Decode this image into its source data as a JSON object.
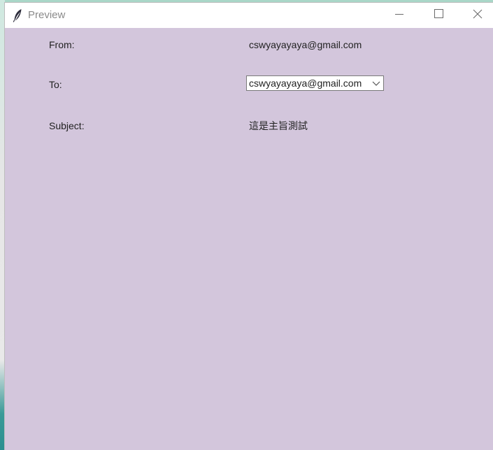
{
  "window": {
    "title": "Preview",
    "icon": "feather-icon",
    "controls": [
      "minimize-icon",
      "maximize-icon",
      "close-icon"
    ]
  },
  "form": {
    "from_label": "From:",
    "from_value": "cswyayayaya@gmail.com",
    "to_label": "To:",
    "to_selected": "cswyayayaya@gmail.com",
    "subject_label": "Subject:",
    "subject_value": "這是主旨測試"
  },
  "colors": {
    "content_background": "#d3c6dc",
    "titlebar_background": "#ffffff",
    "desktop_accent": "#a9d7c8"
  }
}
